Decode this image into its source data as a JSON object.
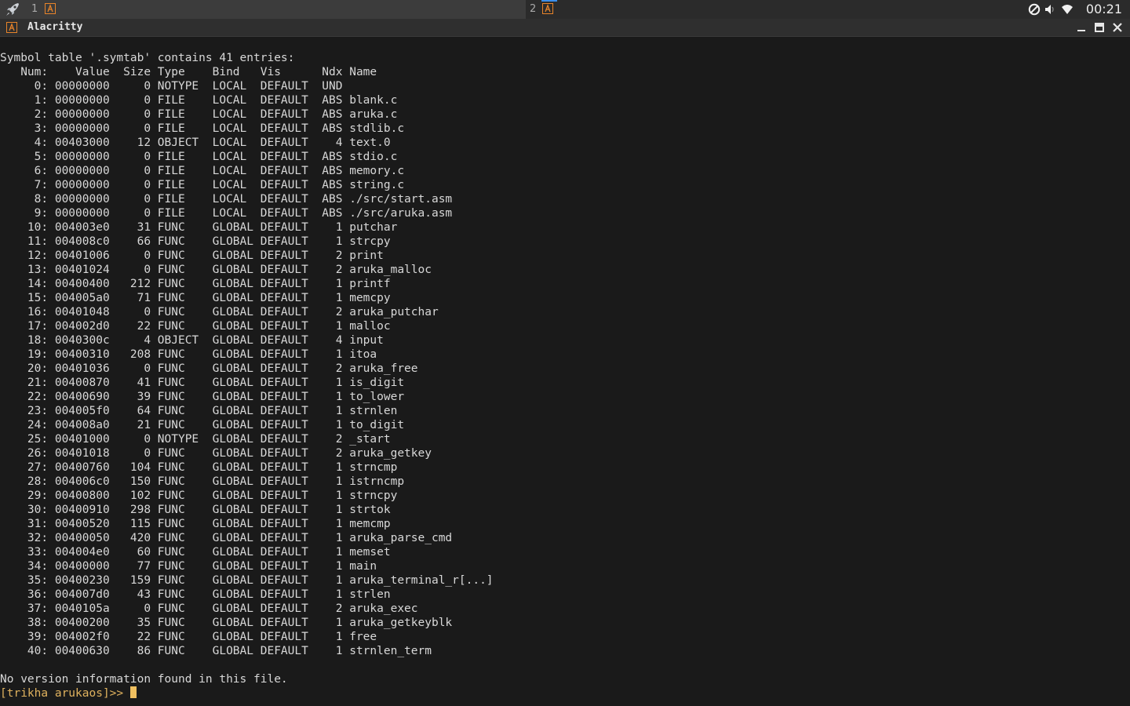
{
  "topbar": {
    "workspace1_label": "1",
    "workspace2_label": "2",
    "clock": "00:21",
    "accent_color": "#3b8eea",
    "icons": [
      "rocket-launcher-icon",
      "alacritty-icon",
      "dnd-icon",
      "volume-icon",
      "wifi-icon"
    ]
  },
  "window": {
    "title": "Alacritty",
    "icons": [
      "minimize-icon",
      "maximize-icon",
      "close-icon"
    ]
  },
  "terminal": {
    "lines": [
      "Symbol table '.symtab' contains 41 entries:",
      "   Num:    Value  Size Type    Bind   Vis      Ndx Name",
      "     0: 00000000     0 NOTYPE  LOCAL  DEFAULT  UND ",
      "     1: 00000000     0 FILE    LOCAL  DEFAULT  ABS blank.c",
      "     2: 00000000     0 FILE    LOCAL  DEFAULT  ABS aruka.c",
      "     3: 00000000     0 FILE    LOCAL  DEFAULT  ABS stdlib.c",
      "     4: 00403000    12 OBJECT  LOCAL  DEFAULT    4 text.0",
      "     5: 00000000     0 FILE    LOCAL  DEFAULT  ABS stdio.c",
      "     6: 00000000     0 FILE    LOCAL  DEFAULT  ABS memory.c",
      "     7: 00000000     0 FILE    LOCAL  DEFAULT  ABS string.c",
      "     8: 00000000     0 FILE    LOCAL  DEFAULT  ABS ./src/start.asm",
      "     9: 00000000     0 FILE    LOCAL  DEFAULT  ABS ./src/aruka.asm",
      "    10: 004003e0    31 FUNC    GLOBAL DEFAULT    1 putchar",
      "    11: 004008c0    66 FUNC    GLOBAL DEFAULT    1 strcpy",
      "    12: 00401006     0 FUNC    GLOBAL DEFAULT    2 print",
      "    13: 00401024     0 FUNC    GLOBAL DEFAULT    2 aruka_malloc",
      "    14: 00400400   212 FUNC    GLOBAL DEFAULT    1 printf",
      "    15: 004005a0    71 FUNC    GLOBAL DEFAULT    1 memcpy",
      "    16: 00401048     0 FUNC    GLOBAL DEFAULT    2 aruka_putchar",
      "    17: 004002d0    22 FUNC    GLOBAL DEFAULT    1 malloc",
      "    18: 0040300c     4 OBJECT  GLOBAL DEFAULT    4 input",
      "    19: 00400310   208 FUNC    GLOBAL DEFAULT    1 itoa",
      "    20: 00401036     0 FUNC    GLOBAL DEFAULT    2 aruka_free",
      "    21: 00400870    41 FUNC    GLOBAL DEFAULT    1 is_digit",
      "    22: 00400690    39 FUNC    GLOBAL DEFAULT    1 to_lower",
      "    23: 004005f0    64 FUNC    GLOBAL DEFAULT    1 strnlen",
      "    24: 004008a0    21 FUNC    GLOBAL DEFAULT    1 to_digit",
      "    25: 00401000     0 NOTYPE  GLOBAL DEFAULT    2 _start",
      "    26: 00401018     0 FUNC    GLOBAL DEFAULT    2 aruka_getkey",
      "    27: 00400760   104 FUNC    GLOBAL DEFAULT    1 strncmp",
      "    28: 004006c0   150 FUNC    GLOBAL DEFAULT    1 istrncmp",
      "    29: 00400800   102 FUNC    GLOBAL DEFAULT    1 strncpy",
      "    30: 00400910   298 FUNC    GLOBAL DEFAULT    1 strtok",
      "    31: 00400520   115 FUNC    GLOBAL DEFAULT    1 memcmp",
      "    32: 00400050   420 FUNC    GLOBAL DEFAULT    1 aruka_parse_cmd",
      "    33: 004004e0    60 FUNC    GLOBAL DEFAULT    1 memset",
      "    34: 00400000    77 FUNC    GLOBAL DEFAULT    1 main",
      "    35: 00400230   159 FUNC    GLOBAL DEFAULT    1 aruka_terminal_r[...]",
      "    36: 004007d0    43 FUNC    GLOBAL DEFAULT    1 strlen",
      "    37: 0040105a     0 FUNC    GLOBAL DEFAULT    2 aruka_exec",
      "    38: 00400200    35 FUNC    GLOBAL DEFAULT    1 aruka_getkeyblk",
      "    39: 004002f0    22 FUNC    GLOBAL DEFAULT    1 free",
      "    40: 00400630    86 FUNC    GLOBAL DEFAULT    1 strnlen_term",
      "",
      "No version information found in this file."
    ],
    "prompt": "[trikha arukaos]>> ",
    "prompt_color": "#e0b25e"
  }
}
